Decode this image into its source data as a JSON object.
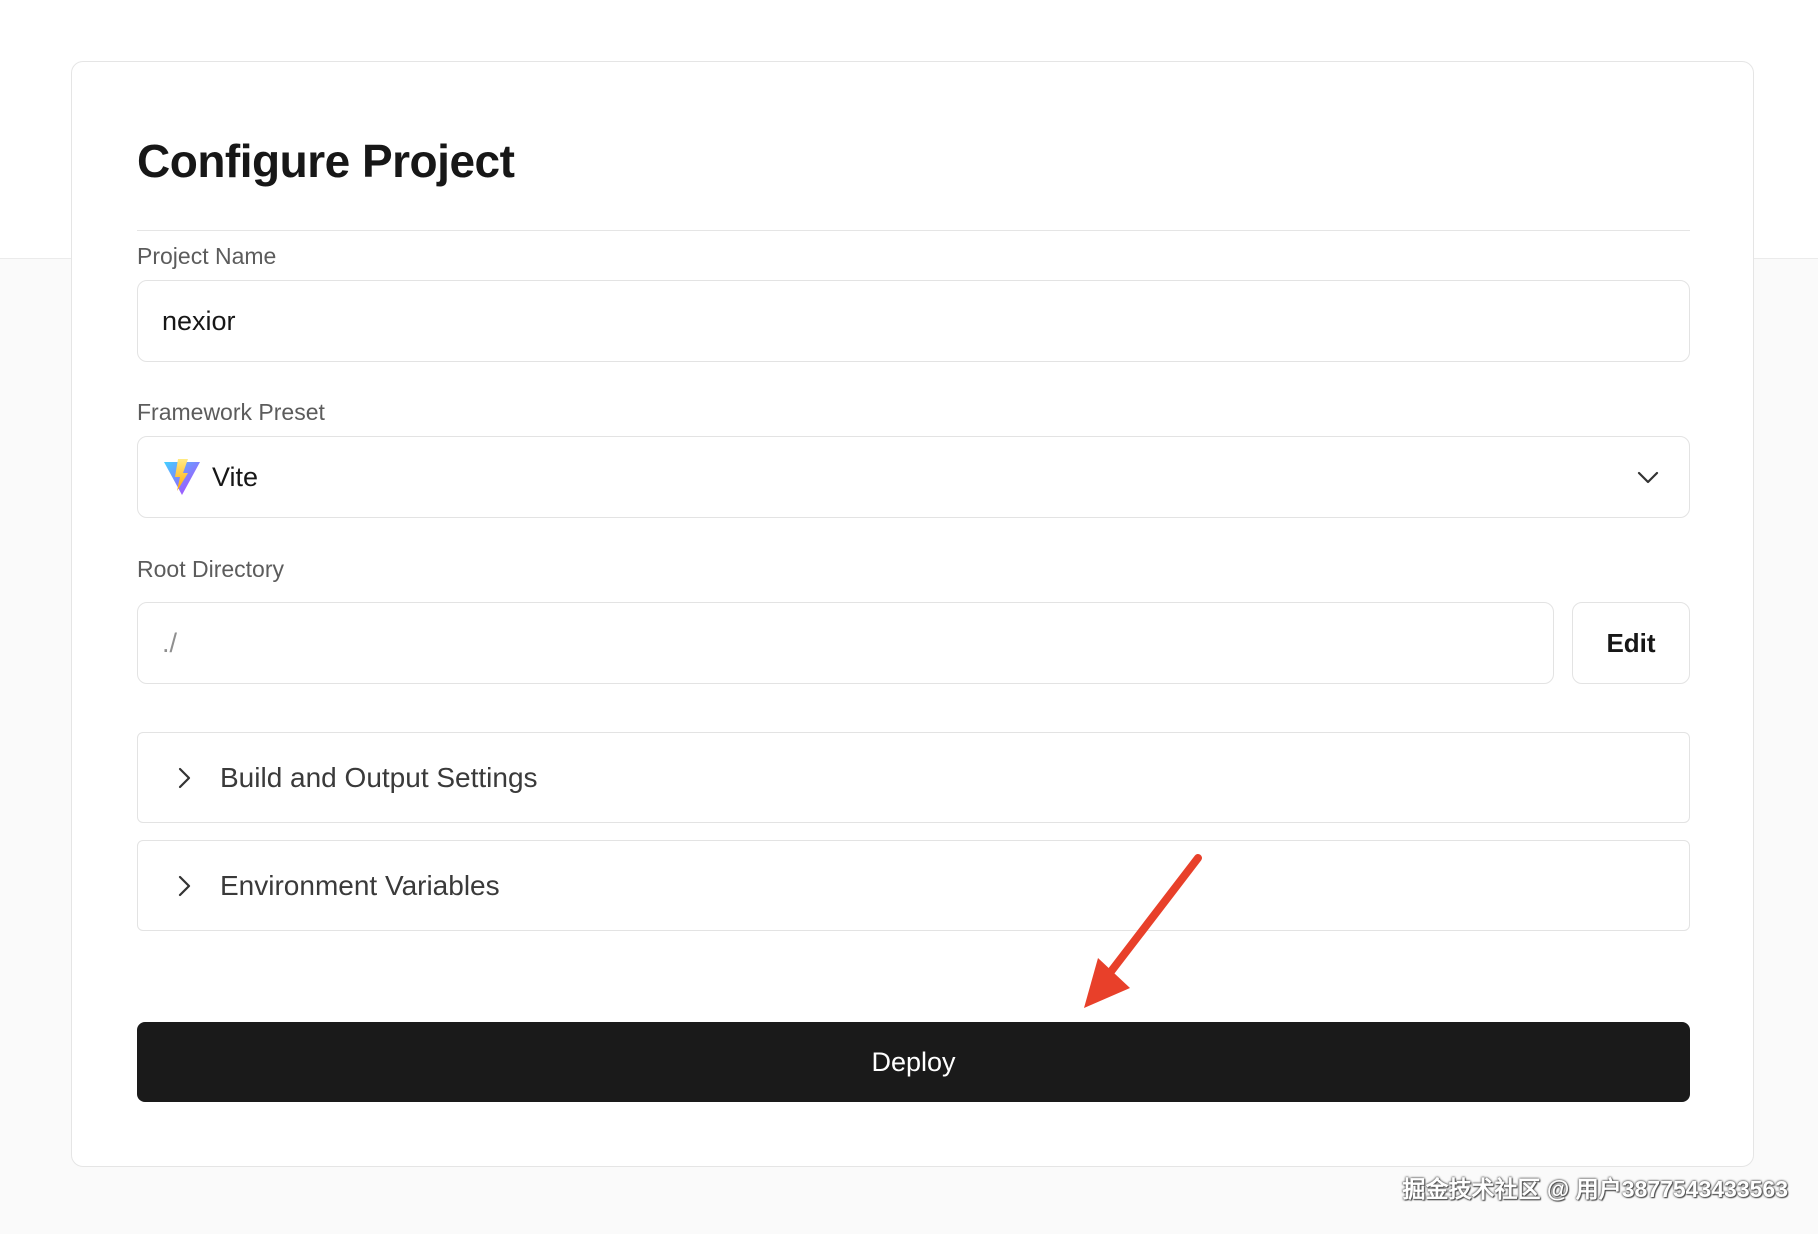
{
  "page": {
    "title": "Configure Project"
  },
  "project_name": {
    "label": "Project Name",
    "value": "nexior"
  },
  "framework_preset": {
    "label": "Framework Preset",
    "value": "Vite",
    "icon": "vite-logo-icon"
  },
  "root_directory": {
    "label": "Root Directory",
    "value": "./",
    "edit_label": "Edit"
  },
  "sections": [
    {
      "label": "Build and Output Settings",
      "icon": "chevron-right-icon"
    },
    {
      "label": "Environment Variables",
      "icon": "chevron-right-icon"
    }
  ],
  "deploy": {
    "label": "Deploy"
  },
  "annotation": {
    "color": "#e8402a"
  },
  "watermark": {
    "text": "掘金技术社区 @ 用户3877543433563"
  },
  "colors": {
    "deploy_bg": "#1a1a1a",
    "border": "#e3e3e3",
    "label": "#5c5c5c"
  }
}
